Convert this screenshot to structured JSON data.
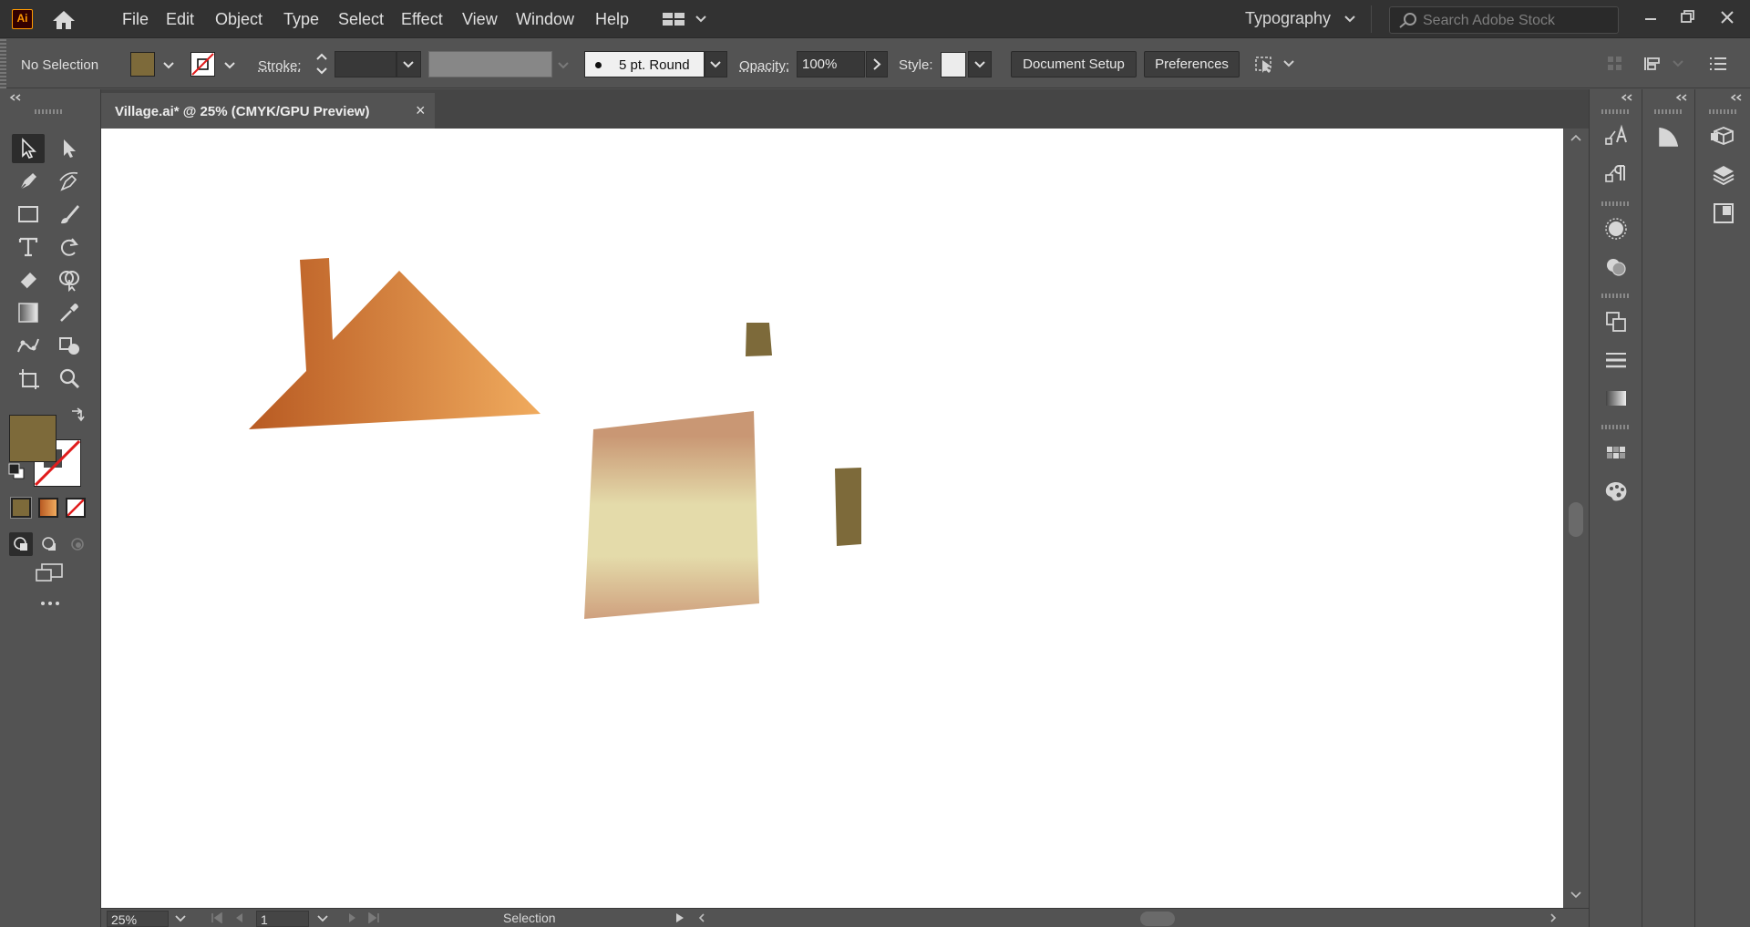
{
  "app": {
    "logo_text": "Ai"
  },
  "menu": [
    "File",
    "Edit",
    "Object",
    "Type",
    "Select",
    "Effect",
    "View",
    "Window",
    "Help"
  ],
  "workspace": {
    "label": "Typography"
  },
  "search": {
    "placeholder": "Search Adobe Stock"
  },
  "control": {
    "selection_label": "No Selection",
    "fill_color": "#7d6a3a",
    "stroke_label": "Stroke:",
    "brush_label": "5 pt. Round",
    "opacity_label": "Opacity:",
    "opacity_value": "100%",
    "style_label": "Style:",
    "doc_setup_label": "Document Setup",
    "preferences_label": "Preferences"
  },
  "document": {
    "tab_title": "Village.ai* @ 25% (CMYK/GPU Preview)",
    "close_glyph": "×"
  },
  "status": {
    "zoom": "25%",
    "artboard": "1",
    "tool": "Selection"
  },
  "colors": {
    "roof_start": "#b85a22",
    "roof_end": "#f0ab5e",
    "wall_top": "#c99774",
    "wall_mid": "#e4dbaa",
    "wall_bottom": "#cfa07e",
    "olive": "#7d6a3a"
  }
}
